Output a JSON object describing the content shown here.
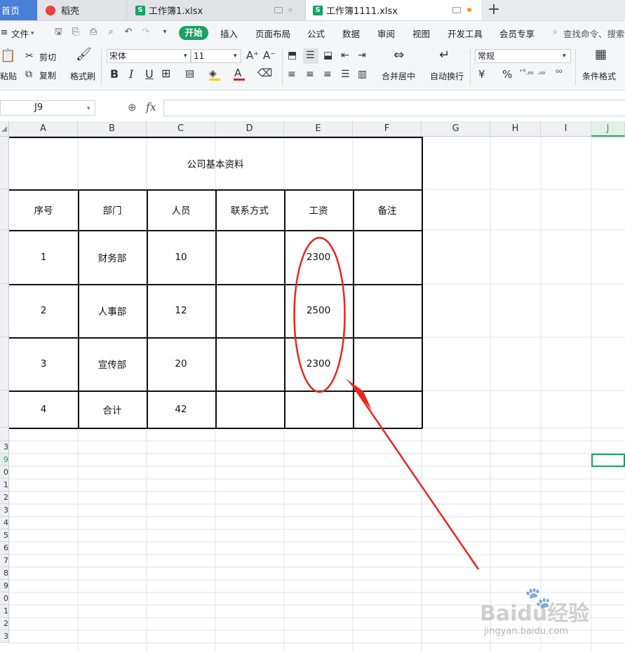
{
  "tabs": {
    "home": "首页",
    "daoke": "稻壳",
    "wb1": "工作簿1.xlsx",
    "wb2": "工作簿1111.xlsx"
  },
  "menu": {
    "file": "文件",
    "start": "开始",
    "items": [
      "插入",
      "页面布局",
      "公式",
      "数据",
      "审阅",
      "视图",
      "开发工具",
      "会员专享"
    ],
    "search": "查找命令、搜索"
  },
  "ribbon": {
    "paste": "粘贴",
    "cut": "剪切",
    "copy": "复制",
    "format_painter": "格式刷",
    "font_name": "宋体",
    "font_size": "11",
    "bold": "B",
    "italic": "I",
    "underline": "U",
    "merge": "合并居中",
    "wrap": "自动换行",
    "number_format": "常规",
    "currency": "¥",
    "percent": "%",
    "dec_add": "⁺⁰.₀₀",
    "dec_sub": ".₀₀",
    "cond_format": "条件格式"
  },
  "formula_bar": {
    "cell_ref": "J9",
    "fx": "fx",
    "value": ""
  },
  "columns": [
    "A",
    "B",
    "C",
    "D",
    "E",
    "F",
    "G",
    "H",
    "I",
    "J"
  ],
  "row_numbers": [
    "3",
    "9",
    "0",
    "1",
    "2",
    "3",
    "4",
    "5",
    "6",
    "7",
    "8",
    "9",
    "0",
    "1",
    "2",
    "3"
  ],
  "sheet": {
    "title": "公司基本资料",
    "headers": [
      "序号",
      "部门",
      "人员",
      "联系方式",
      "工资",
      "备注"
    ],
    "rows": [
      [
        "1",
        "财务部",
        "10",
        "",
        "2300",
        ""
      ],
      [
        "2",
        "人事部",
        "12",
        "",
        "2500",
        ""
      ],
      [
        "3",
        "宣传部",
        "20",
        "",
        "2300",
        ""
      ],
      [
        "4",
        "合计",
        "42",
        "",
        "",
        ""
      ]
    ]
  },
  "annotation": {
    "color": "#e8271f"
  },
  "watermark": {
    "text": "Baidu经验",
    "sub": "jingyan.baidu.com"
  },
  "colors": {
    "accent": "#1aa260",
    "home_tab": "#4a7fd8",
    "tab_dot": "#f39c12"
  }
}
